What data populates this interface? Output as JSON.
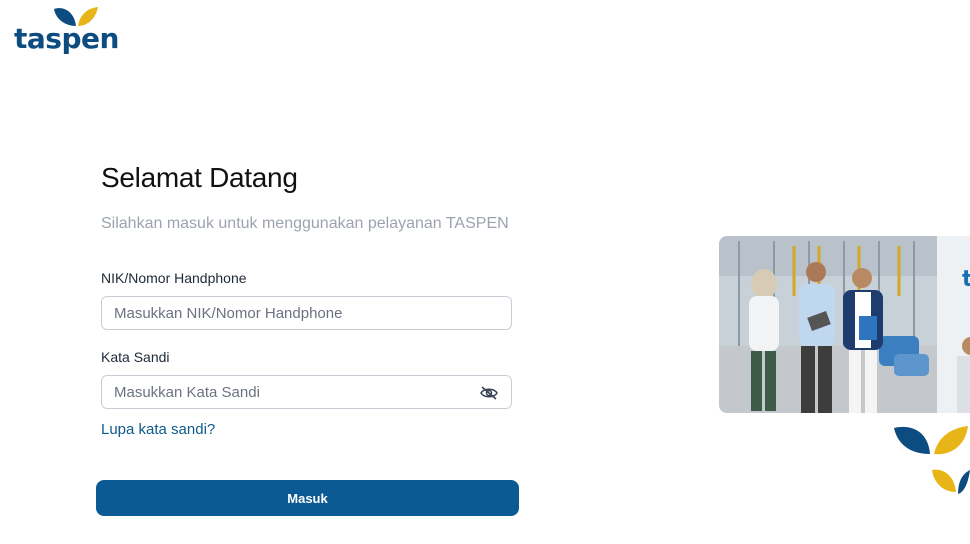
{
  "brand": {
    "logo_text": "taspen",
    "primary_color": "#0c5a93",
    "accent_color": "#e8b518"
  },
  "login": {
    "title": "Selamat Datang",
    "subtitle": "Silahkan masuk untuk menggunakan pelayanan TASPEN",
    "nik_label": "NIK/Nomor Handphone",
    "nik_placeholder": "Masukkan NIK/Nomor Handphone",
    "nik_value": "",
    "password_label": "Kata Sandi",
    "password_placeholder": "Masukkan Kata Sandi",
    "password_value": "",
    "password_toggle_icon": "eye-slash-icon",
    "forgot_link": "Lupa kata sandi?",
    "submit_label": "Masuk"
  },
  "hero": {
    "image_subject": "office-team-photo",
    "decor_icon": "leaf-icon"
  }
}
